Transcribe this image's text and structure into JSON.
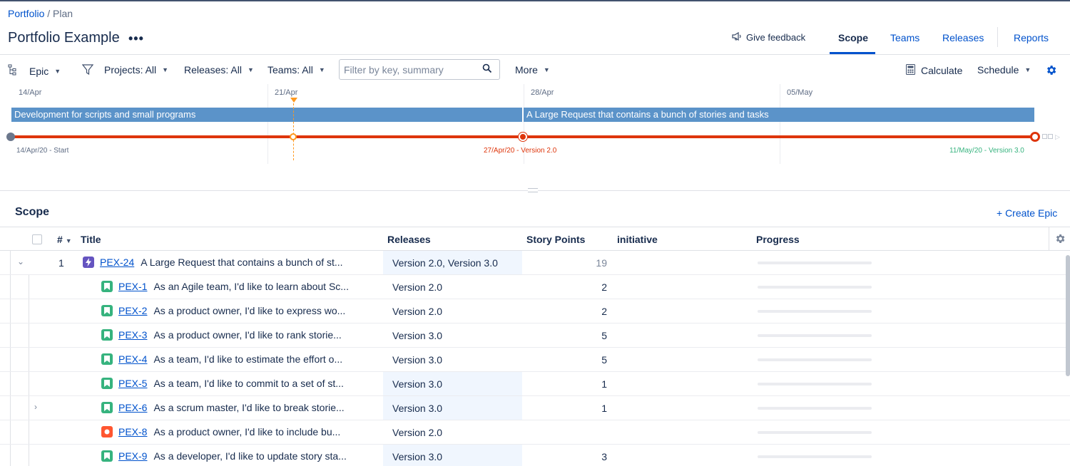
{
  "breadcrumb": {
    "root": "Portfolio",
    "separator": "/",
    "current": "Plan"
  },
  "header": {
    "title": "Portfolio Example",
    "more": "•••",
    "feedback": "Give feedback",
    "tabs": [
      "Scope",
      "Teams",
      "Releases",
      "Reports"
    ],
    "active_tab": "Scope"
  },
  "toolbar": {
    "hierarchy": "Epic",
    "projects": "Projects: All",
    "releases": "Releases: All",
    "teams": "Teams: All",
    "filter_placeholder": "Filter by key, summary",
    "filter_value": "",
    "more": "More",
    "calculate": "Calculate",
    "schedule": "Schedule"
  },
  "timeline": {
    "dates": [
      "14/Apr",
      "21/Apr",
      "28/Apr",
      "05/May"
    ],
    "bars": [
      {
        "label": "Development for scripts and small programs",
        "color": "#5b93c9"
      },
      {
        "label": "A Large Request that contains a bunch of stories and tasks",
        "color": "#5b93c9"
      }
    ],
    "milestones": [
      {
        "label": "14/Apr/20 - Start",
        "color": "#5e6c84"
      },
      {
        "label": "27/Apr/20 - Version 2.0",
        "color": "#de350b"
      },
      {
        "label": "11/May/20 - Version 3.0",
        "color": "#36b37e"
      }
    ]
  },
  "scope": {
    "heading": "Scope",
    "create": "+ Create Epic",
    "columns": {
      "num": "#",
      "title": "Title",
      "releases": "Releases",
      "story_points": "Story Points",
      "initiative": "initiative",
      "progress": "Progress"
    },
    "rows": [
      {
        "num": "1",
        "key": "PEX-24",
        "type": "epic",
        "summary": "A Large Request that contains a bunch of st...",
        "releases": "Version 2.0, Version 3.0",
        "sp": "19",
        "highlight": true,
        "progress": 0
      },
      {
        "num": "",
        "key": "PEX-1",
        "type": "story",
        "summary": "As an Agile team, I'd like to learn about Sc...",
        "releases": "Version 2.0",
        "sp": "2",
        "highlight": false,
        "progress": 0
      },
      {
        "num": "",
        "key": "PEX-2",
        "type": "story",
        "summary": "As a product owner, I'd like to express wo...",
        "releases": "Version 2.0",
        "sp": "2",
        "highlight": false,
        "progress": 0
      },
      {
        "num": "",
        "key": "PEX-3",
        "type": "story",
        "summary": "As a product owner, I'd like to rank storie...",
        "releases": "Version 3.0",
        "sp": "5",
        "highlight": false,
        "progress": 0
      },
      {
        "num": "",
        "key": "PEX-4",
        "type": "story",
        "summary": "As a team, I'd like to estimate the effort o...",
        "releases": "Version 3.0",
        "sp": "5",
        "highlight": false,
        "progress": 0
      },
      {
        "num": "",
        "key": "PEX-5",
        "type": "story",
        "summary": "As a team, I'd like to commit to a set of st...",
        "releases": "Version 3.0",
        "sp": "1",
        "highlight": true,
        "progress": 0
      },
      {
        "num": "",
        "key": "PEX-6",
        "type": "story",
        "summary": "As a scrum master, I'd like to break storie...",
        "releases": "Version 3.0",
        "sp": "1",
        "highlight": true,
        "progress": 0
      },
      {
        "num": "",
        "key": "PEX-8",
        "type": "bug",
        "summary": "As a product owner, I'd like to include bu...",
        "releases": "Version 2.0",
        "sp": "",
        "highlight": false,
        "progress": 0
      },
      {
        "num": "",
        "key": "PEX-9",
        "type": "story",
        "summary": "As a developer, I'd like to update story sta...",
        "releases": "Version 3.0",
        "sp": "3",
        "highlight": true,
        "progress": 0
      }
    ]
  },
  "colors": {
    "link": "#0052cc",
    "epic": "#6554c0",
    "story": "#36b37e",
    "bug": "#ff5630",
    "release_highlight": "#f0f6fe"
  }
}
